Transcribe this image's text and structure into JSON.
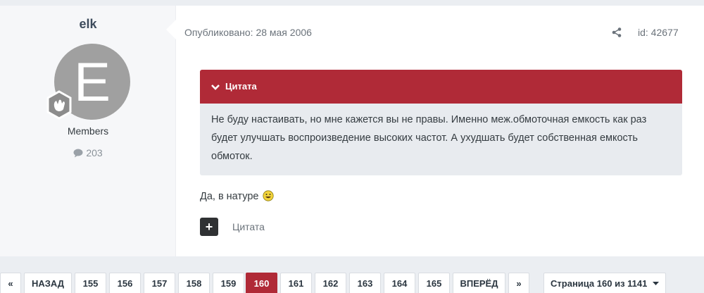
{
  "author": {
    "name": "elk",
    "avatar_letter": "E",
    "group": "Members",
    "post_count": "203"
  },
  "post": {
    "published": "Опубликовано: 28 мая 2006",
    "id": "id: 42677",
    "quote_title": "Цитата",
    "quote_text": "Не буду настаивать, но мне кажется вы не правы. Именно меж.обмоточная емкость как раз будет улучшать воспроизведение высоких частот. А ухудшать будет собственная емкость обмоток.",
    "text": "Да, в натуре",
    "quote_button_label": "Цитата"
  },
  "pagination": {
    "first": "«",
    "prev": "НАЗАД",
    "pages": [
      "155",
      "156",
      "157",
      "158",
      "159",
      "160",
      "161",
      "162",
      "163",
      "164",
      "165"
    ],
    "current": "160",
    "next": "ВПЕРЁД",
    "last": "»",
    "page_of": "Страница 160 из 1141"
  },
  "colors": {
    "accent": "#b02a37",
    "quote_bg": "#e8ebef",
    "avatar_bg": "#a0a0a0"
  },
  "icons": {
    "share": "share-icon",
    "rank": "rank-badge-icon",
    "comment": "comment-icon",
    "chevron": "chevron-down-icon",
    "smiley": "smiley-icon",
    "plus": "plus-icon"
  }
}
